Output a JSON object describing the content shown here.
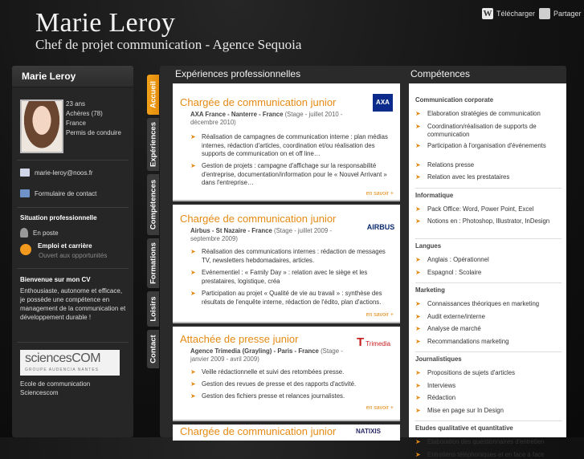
{
  "header": {
    "name": "Marie Leroy",
    "subtitle": "Chef de projet communication - Agence Sequoia",
    "download_label": "Télécharger",
    "share_label": "Partager"
  },
  "profile": {
    "title": "Marie Leroy",
    "age": "23 ans",
    "city": "Achères (78)",
    "country": "France",
    "license": "Permis de conduire",
    "email": "marie-leroy@noos.fr",
    "contact_form": "Formulaire de contact",
    "situation_title": "Situation professionnelle",
    "status": "En poste",
    "jobs_title": "Emploi et carrière",
    "jobs_sub": "Ouvert aux opportunités",
    "about_title": "Bienvenue sur mon CV",
    "about_text": "Enthousiaste, autonome et efficace, je possède une compétence en management de la communication et développement durable !",
    "school_logo_main": "sciencesCOM",
    "school_logo_sub": "GROUPE AUDENCIA NANTES",
    "school_line1": "Ecole de communication",
    "school_line2": "Sciencescom"
  },
  "tabs": [
    "Accueil",
    "Expériences",
    "Compétences",
    "Formations",
    "Loisirs",
    "Contact"
  ],
  "experiences": {
    "heading": "Expériences professionnelles",
    "more_label": "en savoir +",
    "items": [
      {
        "title": "Chargée de communication junior",
        "company": "AXA France - Nanterre - France",
        "dates": "(Stage - juillet 2010 - décembre 2010)",
        "logo": "AXA",
        "bullets": [
          "Réalisation de campagnes de communication interne : plan médias internes, rédaction d'articles, coordination et/ou réalisation des supports de communication on et off line…",
          "Gestion de projets : campagne d'affichage sur la responsabilité d'entreprise, documentation/information pour le « Nouvel Arrivant » dans l'entreprise…"
        ]
      },
      {
        "title": "Chargée de communication junior",
        "company": "Airbus - St Nazaire - France",
        "dates": "(Stage - juillet 2009 - septembre 2009)",
        "logo": "AIRBUS",
        "bullets": [
          "Réalisation des communications internes : rédaction de messages TV, newsletters hebdomadaires, articles.",
          "Evénementiel : « Family Day » : relation avec le siège et les prestataires, logistique, créa",
          "Participation au projet « Qualité de vie au travail » : synthèse des résultats de l'enquête interne, rédaction de l'édito, plan d'actions."
        ]
      },
      {
        "title": "Attachée de presse junior",
        "company": "Agence Trimedia (Grayling) - Paris - France",
        "dates": "(Stage - janvier 2009 - avril 2009)",
        "logo": "Trimedia",
        "bullets": [
          "Veille rédactionnelle et suivi des retombées presse.",
          "Gestion des revues de presse et des rapports d'activité.",
          "Gestion des fichiers presse et relances journalistes."
        ]
      },
      {
        "title": "Chargée de communication junior",
        "logo": "NATIXIS"
      }
    ]
  },
  "competences": {
    "heading": "Compétences",
    "groups": [
      {
        "title": "Communication corporate",
        "items": [
          "Elaboration stratégies de communication",
          "Coordination/réalisation de supports de communication",
          "Participation à l'organisation d'événements",
          "Relations presse",
          "Relation avec les prestataires"
        ]
      },
      {
        "title": "Informatique",
        "items": [
          "Pack Office: Word, Power Point, Excel",
          "Notions en : Photoshop, Illustrator, InDesign"
        ]
      },
      {
        "title": "Langues",
        "items": [
          "Anglais : Opérationnel",
          "Espagnol : Scolaire"
        ]
      },
      {
        "title": "Marketing",
        "items": [
          "Connaissances théoriques en marketing",
          "Audit externe/interne",
          "Analyse de marché",
          "Recommandations marketing"
        ]
      },
      {
        "title": "Journalistiques",
        "items": [
          "Propositions de sujets d'articles",
          "Interviews",
          "Rédaction",
          "Mise en page sur In Design"
        ]
      },
      {
        "title": "Etudes qualitative et quantitative",
        "items": [
          "Elaboration des questionnaires d'entretien",
          "Entretiens téléphoniques et en face à face"
        ]
      }
    ]
  },
  "colors": {
    "accent": "#e58a14",
    "panel": "#2a2a2a",
    "background": "#111111"
  }
}
